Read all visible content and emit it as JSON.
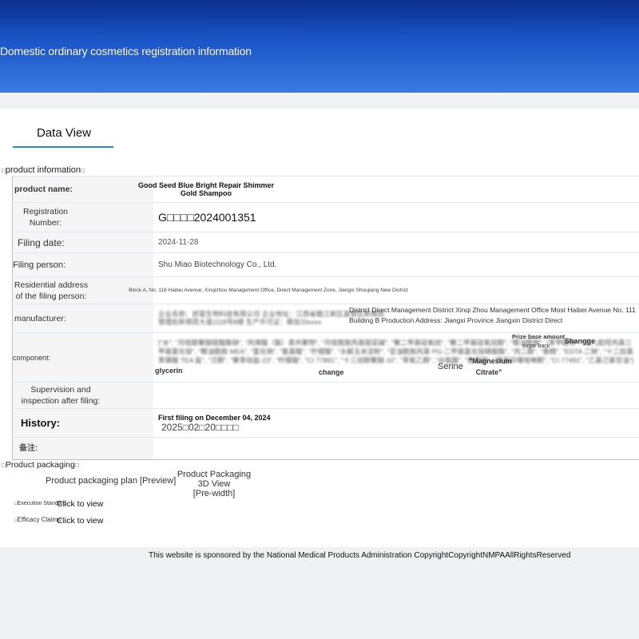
{
  "header": {
    "title": "Domestic ordinary cosmetics registration information"
  },
  "tabs": {
    "data_view": "Data View"
  },
  "product_info": {
    "section_title": "product information",
    "rows": {
      "product_name": {
        "label": "product name:",
        "value": "Good Seed Blue Bright Repair Shimmer Gold Shampoo"
      },
      "registration_number": {
        "label": "Registration Number:",
        "value": "G□□□□2024001351"
      },
      "filing_date": {
        "label": "Filing date:",
        "value": "2024-11-28"
      },
      "filing_person": {
        "label": "Filing person:",
        "value": "Shu Miao Biotechnology Co., Ltd."
      },
      "residential_address": {
        "label": "Residential address of the filing person:",
        "value": "Block A, No. 118 Haibei Avenue, Xinqizhou Management Office, Direct Management Zone, Jiangxi Shoujiang New District"
      },
      "manufacturer": {
        "label": "manufacturer:",
        "value_cn": "企业名称：舒苗生物科技有限公司 企业地址：江西省赣江新区直管区新祺周管理处新祺周大道1118号8楼 生产许可证：赣妆20xxxx",
        "value_en": "District Direct Management District Xinqi Zhou Management Office Most Haibei Avenue No. 111 Building B Production Address: Jiangxi Province Jiangxin District Direct"
      },
      "component": {
        "label": "component:",
        "value_cn": "[\"水\", \"月桂醇聚醚硫酸酯钠\", \"丙烯酸（酯）类共聚物\", \"月桂酰胺丙基甜菜碱\", \"聚二甲基硅氧烷\", \"聚二甲基硅氧烷醇\", \"椰油酰胺\", \"苯甲酸钠\", \"瓜儿胶羟丙基三甲基氯化铵\", \"椰油酰胺 MEA\", \"氯化钠\", \"氨基酸\", \"柠檬酸\", \"水解玉米淀粉\", \"亚油酰胺丙基 PG-二甲基氯化铵磷酸酯\", \"丙二醇\", \"香精\", \"EDTA 二钠\", \"十二烷基苯磺酸 TEA 盐\", \"泛醇\", \"聚季铵盐-23\", \"柠檬酸\", \"CI 77891\", \"十三烷醇聚醚-10\", \"苯氧乙醇\", \"谷氨酸\", \"香草醇\", \"甲基异噻唑啉酮\", \"CI 77491\", \"乙基己基甘油\"]",
        "glycerin": "glycerin",
        "change": "change",
        "serine": "Serine",
        "magnesium": "\"Magnesium Citrate\"",
        "prize": "Prize base amount",
        "sugar": "sugar back",
        "shangge": "Shangge"
      },
      "supervision": {
        "label": "Supervision and inspection after filing:",
        "value": ""
      },
      "history": {
        "label": "History:",
        "first_filing": "First filing on December 04, 2024",
        "next_date": "2025□02□20□□□□"
      },
      "remarks": {
        "label": "备注:",
        "value": ""
      }
    }
  },
  "product_packaging": {
    "section_title": "Product packaging",
    "plan_link": "Product packaging plan [Preview]",
    "view3d_title": "Product Packaging 3D View",
    "view3d_sub": "[Pre-width]",
    "execution_label": "Execution Standard",
    "efficacy_label": "Efficacy Claims",
    "click_label": "Click to view"
  },
  "footer": {
    "text": "This website is sponsored by the National Medical Products Administration CopyrightCopyrightNMPAAllRightsReserved"
  },
  "colors": {
    "banner_top": "#0b2f8e",
    "banner_bottom": "#3a7be0",
    "tab_underline": "#2a8ad8",
    "table_border": "#a9c4e8"
  }
}
